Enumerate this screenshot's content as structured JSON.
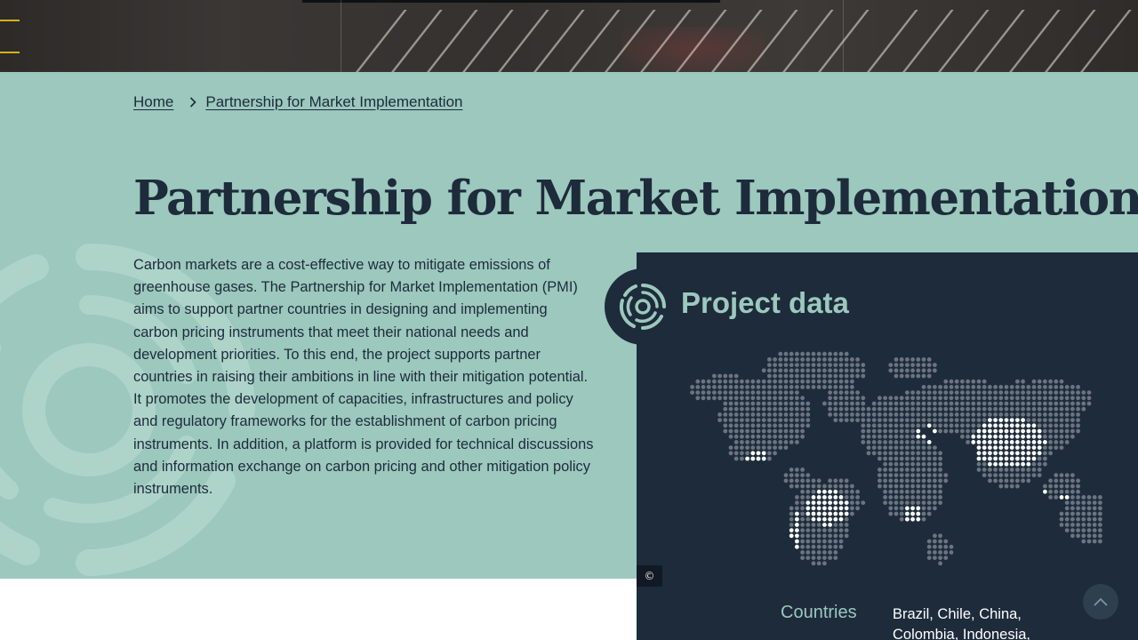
{
  "breadcrumb": {
    "home": "Home",
    "current": "Partnership for Market Implementation"
  },
  "page_title": "Partnership for Market Implementation",
  "description": "Carbon markets are a cost-effective way to mitigate emissions of greenhouse gases. The Partnership for Market Implementation (PMI) aims to support partner countries in designing and implementing carbon pricing instruments that meet their national needs and development priorities. To this end, the project supports partner countries in raising their ambitions in line with their mitigation potential. It promotes the development of capacities, infrastructures and policy and regulatory frameworks for the establishment of carbon pricing instruments. In addition, a platform is provided for technical discussions and information exchange on carbon pricing and other mitigation policy instruments.",
  "project_data": {
    "title": "Project data",
    "countries_label": "Countries",
    "countries_value": "Brazil, Chile, China, Colombia, Indonesia,",
    "copyright_symbol": "©"
  },
  "colors": {
    "accent_green": "#9cc8bd",
    "navy": "#1d2b3b",
    "map_inactive": "#6b7480",
    "map_active": "#ffffff"
  },
  "icons": {
    "breadcrumb_separator": "chevron-right-icon",
    "project_data": "target-rings-icon",
    "scroll_top": "chevron-up-icon",
    "copyright": "copyright-icon"
  }
}
